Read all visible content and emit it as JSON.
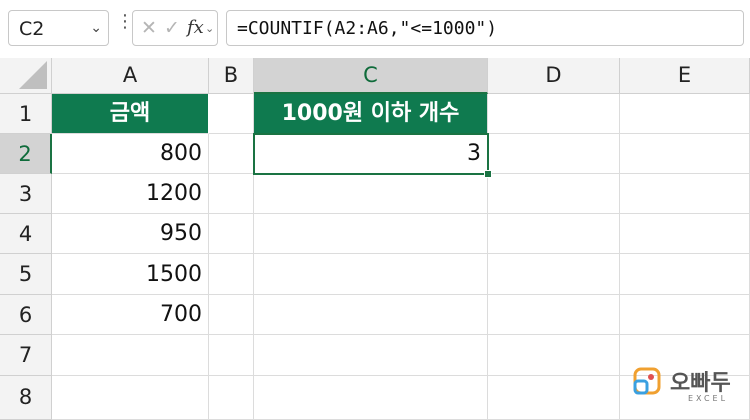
{
  "formula_bar": {
    "name_box": "C2",
    "formula": "=COUNTIF(A2:A6,\"<=1000\")"
  },
  "columns": [
    "A",
    "B",
    "C",
    "D",
    "E"
  ],
  "rows": [
    "1",
    "2",
    "3",
    "4",
    "5",
    "6",
    "7",
    "8"
  ],
  "cells": {
    "A1": "금액",
    "A2": "800",
    "A3": "1200",
    "A4": "950",
    "A5": "1500",
    "A6": "700",
    "C1": "1000원 이하 개수",
    "C2": "3"
  },
  "selected_cell": "C2",
  "colors": {
    "header_fill": "#0f7a4f",
    "selection": "#1a7343"
  },
  "watermark": {
    "brand": "오빠두",
    "sub": "EXCEL"
  }
}
